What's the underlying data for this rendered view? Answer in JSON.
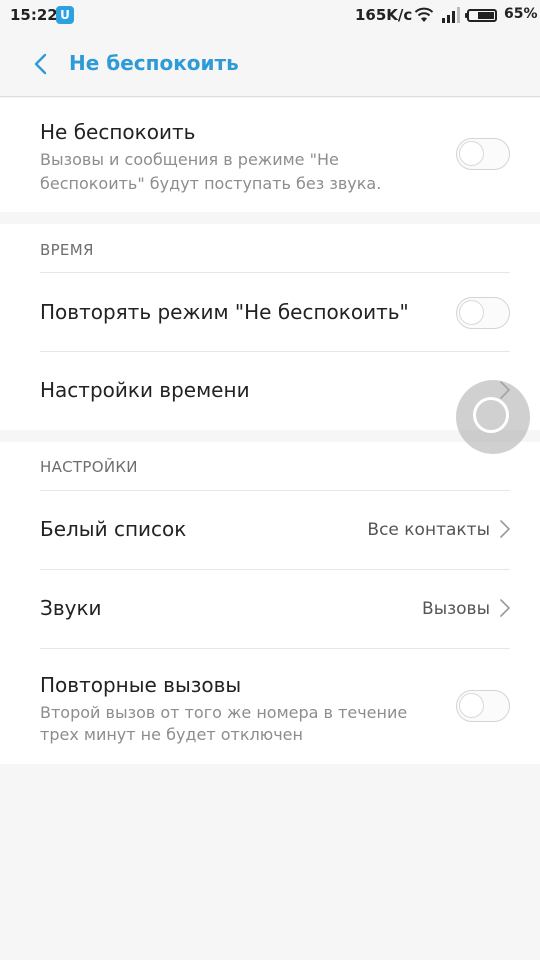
{
  "status_bar": {
    "time": "15:22",
    "app_badge": "U",
    "speed": "165K/c",
    "battery_percent": "65%",
    "battery_level": 0.65
  },
  "header": {
    "title": "Не беспокоить"
  },
  "dnd": {
    "title": "Не беспокоить",
    "subtitle_line1": "Вызовы и сообщения в режиме \"Не",
    "subtitle_line2": "беспокоить\" будут поступать без звука.",
    "enabled": false
  },
  "time_section": {
    "label": "ВРЕМЯ",
    "repeat": {
      "title": "Повторять режим \"Не беспокоить\"",
      "enabled": false
    },
    "time_settings": {
      "title": "Настройки времени"
    }
  },
  "settings_section": {
    "label": "НАСТРОЙКИ",
    "whitelist": {
      "title": "Белый список",
      "value": "Все контакты"
    },
    "sounds": {
      "title": "Звуки",
      "value": "Вызовы"
    },
    "repeat_calls": {
      "title": "Повторные вызовы",
      "subtitle_line1": "Второй вызов от того же номера в течение",
      "subtitle_line2": "трех минут не будет отключен",
      "enabled": false
    }
  },
  "colors": {
    "accent": "#2e9ad6",
    "background": "#f6f6f6",
    "card": "#ffffff"
  }
}
